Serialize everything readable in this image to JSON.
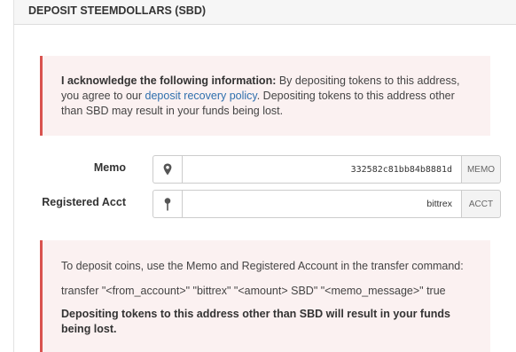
{
  "panel": {
    "title": "DEPOSIT STEEMDOLLARS (SBD)"
  },
  "notice": {
    "bold": "I acknowledge the following information:",
    "text_before_link": " By depositing tokens to this address, you agree to our ",
    "link": "deposit recovery policy",
    "text_after_link": ". Depositing tokens to this address other than SBD may result in your funds being lost."
  },
  "form": {
    "memo": {
      "label": "Memo",
      "value": "332582c81bb84b8881d",
      "addon": "MEMO",
      "icon": "map-marker-icon"
    },
    "account": {
      "label": "Registered Acct",
      "value": "bittrex",
      "addon": "ACCT",
      "icon": "pushpin-icon"
    }
  },
  "instructions": {
    "line1": "To deposit coins, use the Memo and Registered Account in the transfer command:",
    "line2": "transfer \"<from_account>\" \"bittrex\" \"<amount> SBD\" \"<memo_message>\" true",
    "warning": "Depositing tokens to this address other than SBD will result in your funds being lost."
  },
  "colors": {
    "alert_border": "#d9534f",
    "alert_bg": "#fbf1f1",
    "link": "#2f6fad"
  }
}
